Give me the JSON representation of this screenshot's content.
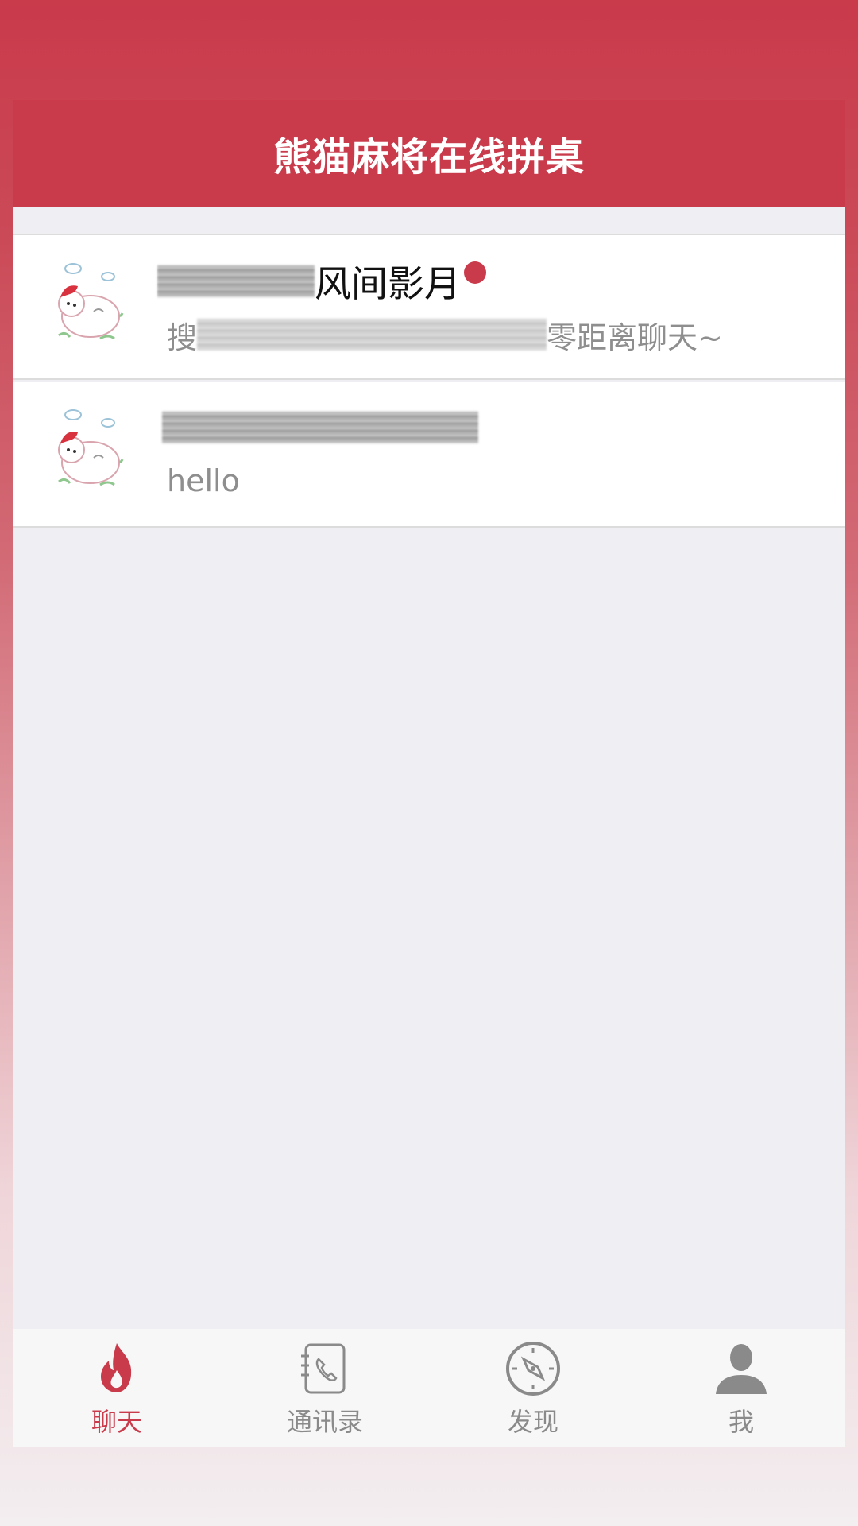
{
  "header": {
    "title": "熊猫麻将在线拼桌"
  },
  "conversations": [
    {
      "name_visible": "风间影月",
      "preview_prefix": "搜",
      "preview_suffix": "零距离聊天~",
      "unread": true,
      "avatar_icon": "panda-cartoon-avatar"
    },
    {
      "name_visible": "",
      "preview": "hello",
      "unread": false,
      "avatar_icon": "panda-cartoon-avatar"
    }
  ],
  "tabbar": {
    "tabs": [
      {
        "label": "聊天",
        "icon": "flame-icon",
        "active": true
      },
      {
        "label": "通讯录",
        "icon": "contacts-book-icon",
        "active": false
      },
      {
        "label": "发现",
        "icon": "compass-icon",
        "active": false
      },
      {
        "label": "我",
        "icon": "person-icon",
        "active": false
      }
    ]
  },
  "colors": {
    "brand": "#c93a4b",
    "background": "#efeef3",
    "inactive": "#8a8a8a"
  }
}
